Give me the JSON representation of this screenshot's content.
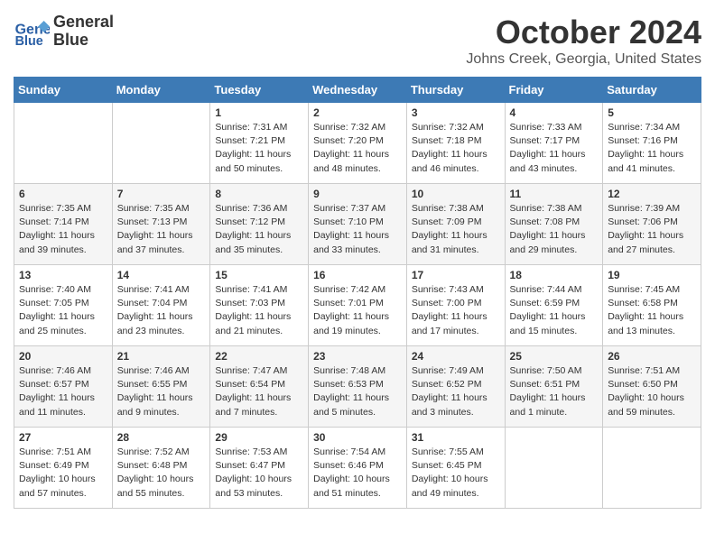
{
  "header": {
    "logo_line1": "General",
    "logo_line2": "Blue",
    "title": "October 2024",
    "subtitle": "Johns Creek, Georgia, United States"
  },
  "weekdays": [
    "Sunday",
    "Monday",
    "Tuesday",
    "Wednesday",
    "Thursday",
    "Friday",
    "Saturday"
  ],
  "weeks": [
    [
      {
        "day": "",
        "detail": ""
      },
      {
        "day": "",
        "detail": ""
      },
      {
        "day": "1",
        "detail": "Sunrise: 7:31 AM\nSunset: 7:21 PM\nDaylight: 11 hours and 50 minutes."
      },
      {
        "day": "2",
        "detail": "Sunrise: 7:32 AM\nSunset: 7:20 PM\nDaylight: 11 hours and 48 minutes."
      },
      {
        "day": "3",
        "detail": "Sunrise: 7:32 AM\nSunset: 7:18 PM\nDaylight: 11 hours and 46 minutes."
      },
      {
        "day": "4",
        "detail": "Sunrise: 7:33 AM\nSunset: 7:17 PM\nDaylight: 11 hours and 43 minutes."
      },
      {
        "day": "5",
        "detail": "Sunrise: 7:34 AM\nSunset: 7:16 PM\nDaylight: 11 hours and 41 minutes."
      }
    ],
    [
      {
        "day": "6",
        "detail": "Sunrise: 7:35 AM\nSunset: 7:14 PM\nDaylight: 11 hours and 39 minutes."
      },
      {
        "day": "7",
        "detail": "Sunrise: 7:35 AM\nSunset: 7:13 PM\nDaylight: 11 hours and 37 minutes."
      },
      {
        "day": "8",
        "detail": "Sunrise: 7:36 AM\nSunset: 7:12 PM\nDaylight: 11 hours and 35 minutes."
      },
      {
        "day": "9",
        "detail": "Sunrise: 7:37 AM\nSunset: 7:10 PM\nDaylight: 11 hours and 33 minutes."
      },
      {
        "day": "10",
        "detail": "Sunrise: 7:38 AM\nSunset: 7:09 PM\nDaylight: 11 hours and 31 minutes."
      },
      {
        "day": "11",
        "detail": "Sunrise: 7:38 AM\nSunset: 7:08 PM\nDaylight: 11 hours and 29 minutes."
      },
      {
        "day": "12",
        "detail": "Sunrise: 7:39 AM\nSunset: 7:06 PM\nDaylight: 11 hours and 27 minutes."
      }
    ],
    [
      {
        "day": "13",
        "detail": "Sunrise: 7:40 AM\nSunset: 7:05 PM\nDaylight: 11 hours and 25 minutes."
      },
      {
        "day": "14",
        "detail": "Sunrise: 7:41 AM\nSunset: 7:04 PM\nDaylight: 11 hours and 23 minutes."
      },
      {
        "day": "15",
        "detail": "Sunrise: 7:41 AM\nSunset: 7:03 PM\nDaylight: 11 hours and 21 minutes."
      },
      {
        "day": "16",
        "detail": "Sunrise: 7:42 AM\nSunset: 7:01 PM\nDaylight: 11 hours and 19 minutes."
      },
      {
        "day": "17",
        "detail": "Sunrise: 7:43 AM\nSunset: 7:00 PM\nDaylight: 11 hours and 17 minutes."
      },
      {
        "day": "18",
        "detail": "Sunrise: 7:44 AM\nSunset: 6:59 PM\nDaylight: 11 hours and 15 minutes."
      },
      {
        "day": "19",
        "detail": "Sunrise: 7:45 AM\nSunset: 6:58 PM\nDaylight: 11 hours and 13 minutes."
      }
    ],
    [
      {
        "day": "20",
        "detail": "Sunrise: 7:46 AM\nSunset: 6:57 PM\nDaylight: 11 hours and 11 minutes."
      },
      {
        "day": "21",
        "detail": "Sunrise: 7:46 AM\nSunset: 6:55 PM\nDaylight: 11 hours and 9 minutes."
      },
      {
        "day": "22",
        "detail": "Sunrise: 7:47 AM\nSunset: 6:54 PM\nDaylight: 11 hours and 7 minutes."
      },
      {
        "day": "23",
        "detail": "Sunrise: 7:48 AM\nSunset: 6:53 PM\nDaylight: 11 hours and 5 minutes."
      },
      {
        "day": "24",
        "detail": "Sunrise: 7:49 AM\nSunset: 6:52 PM\nDaylight: 11 hours and 3 minutes."
      },
      {
        "day": "25",
        "detail": "Sunrise: 7:50 AM\nSunset: 6:51 PM\nDaylight: 11 hours and 1 minute."
      },
      {
        "day": "26",
        "detail": "Sunrise: 7:51 AM\nSunset: 6:50 PM\nDaylight: 10 hours and 59 minutes."
      }
    ],
    [
      {
        "day": "27",
        "detail": "Sunrise: 7:51 AM\nSunset: 6:49 PM\nDaylight: 10 hours and 57 minutes."
      },
      {
        "day": "28",
        "detail": "Sunrise: 7:52 AM\nSunset: 6:48 PM\nDaylight: 10 hours and 55 minutes."
      },
      {
        "day": "29",
        "detail": "Sunrise: 7:53 AM\nSunset: 6:47 PM\nDaylight: 10 hours and 53 minutes."
      },
      {
        "day": "30",
        "detail": "Sunrise: 7:54 AM\nSunset: 6:46 PM\nDaylight: 10 hours and 51 minutes."
      },
      {
        "day": "31",
        "detail": "Sunrise: 7:55 AM\nSunset: 6:45 PM\nDaylight: 10 hours and 49 minutes."
      },
      {
        "day": "",
        "detail": ""
      },
      {
        "day": "",
        "detail": ""
      }
    ]
  ]
}
